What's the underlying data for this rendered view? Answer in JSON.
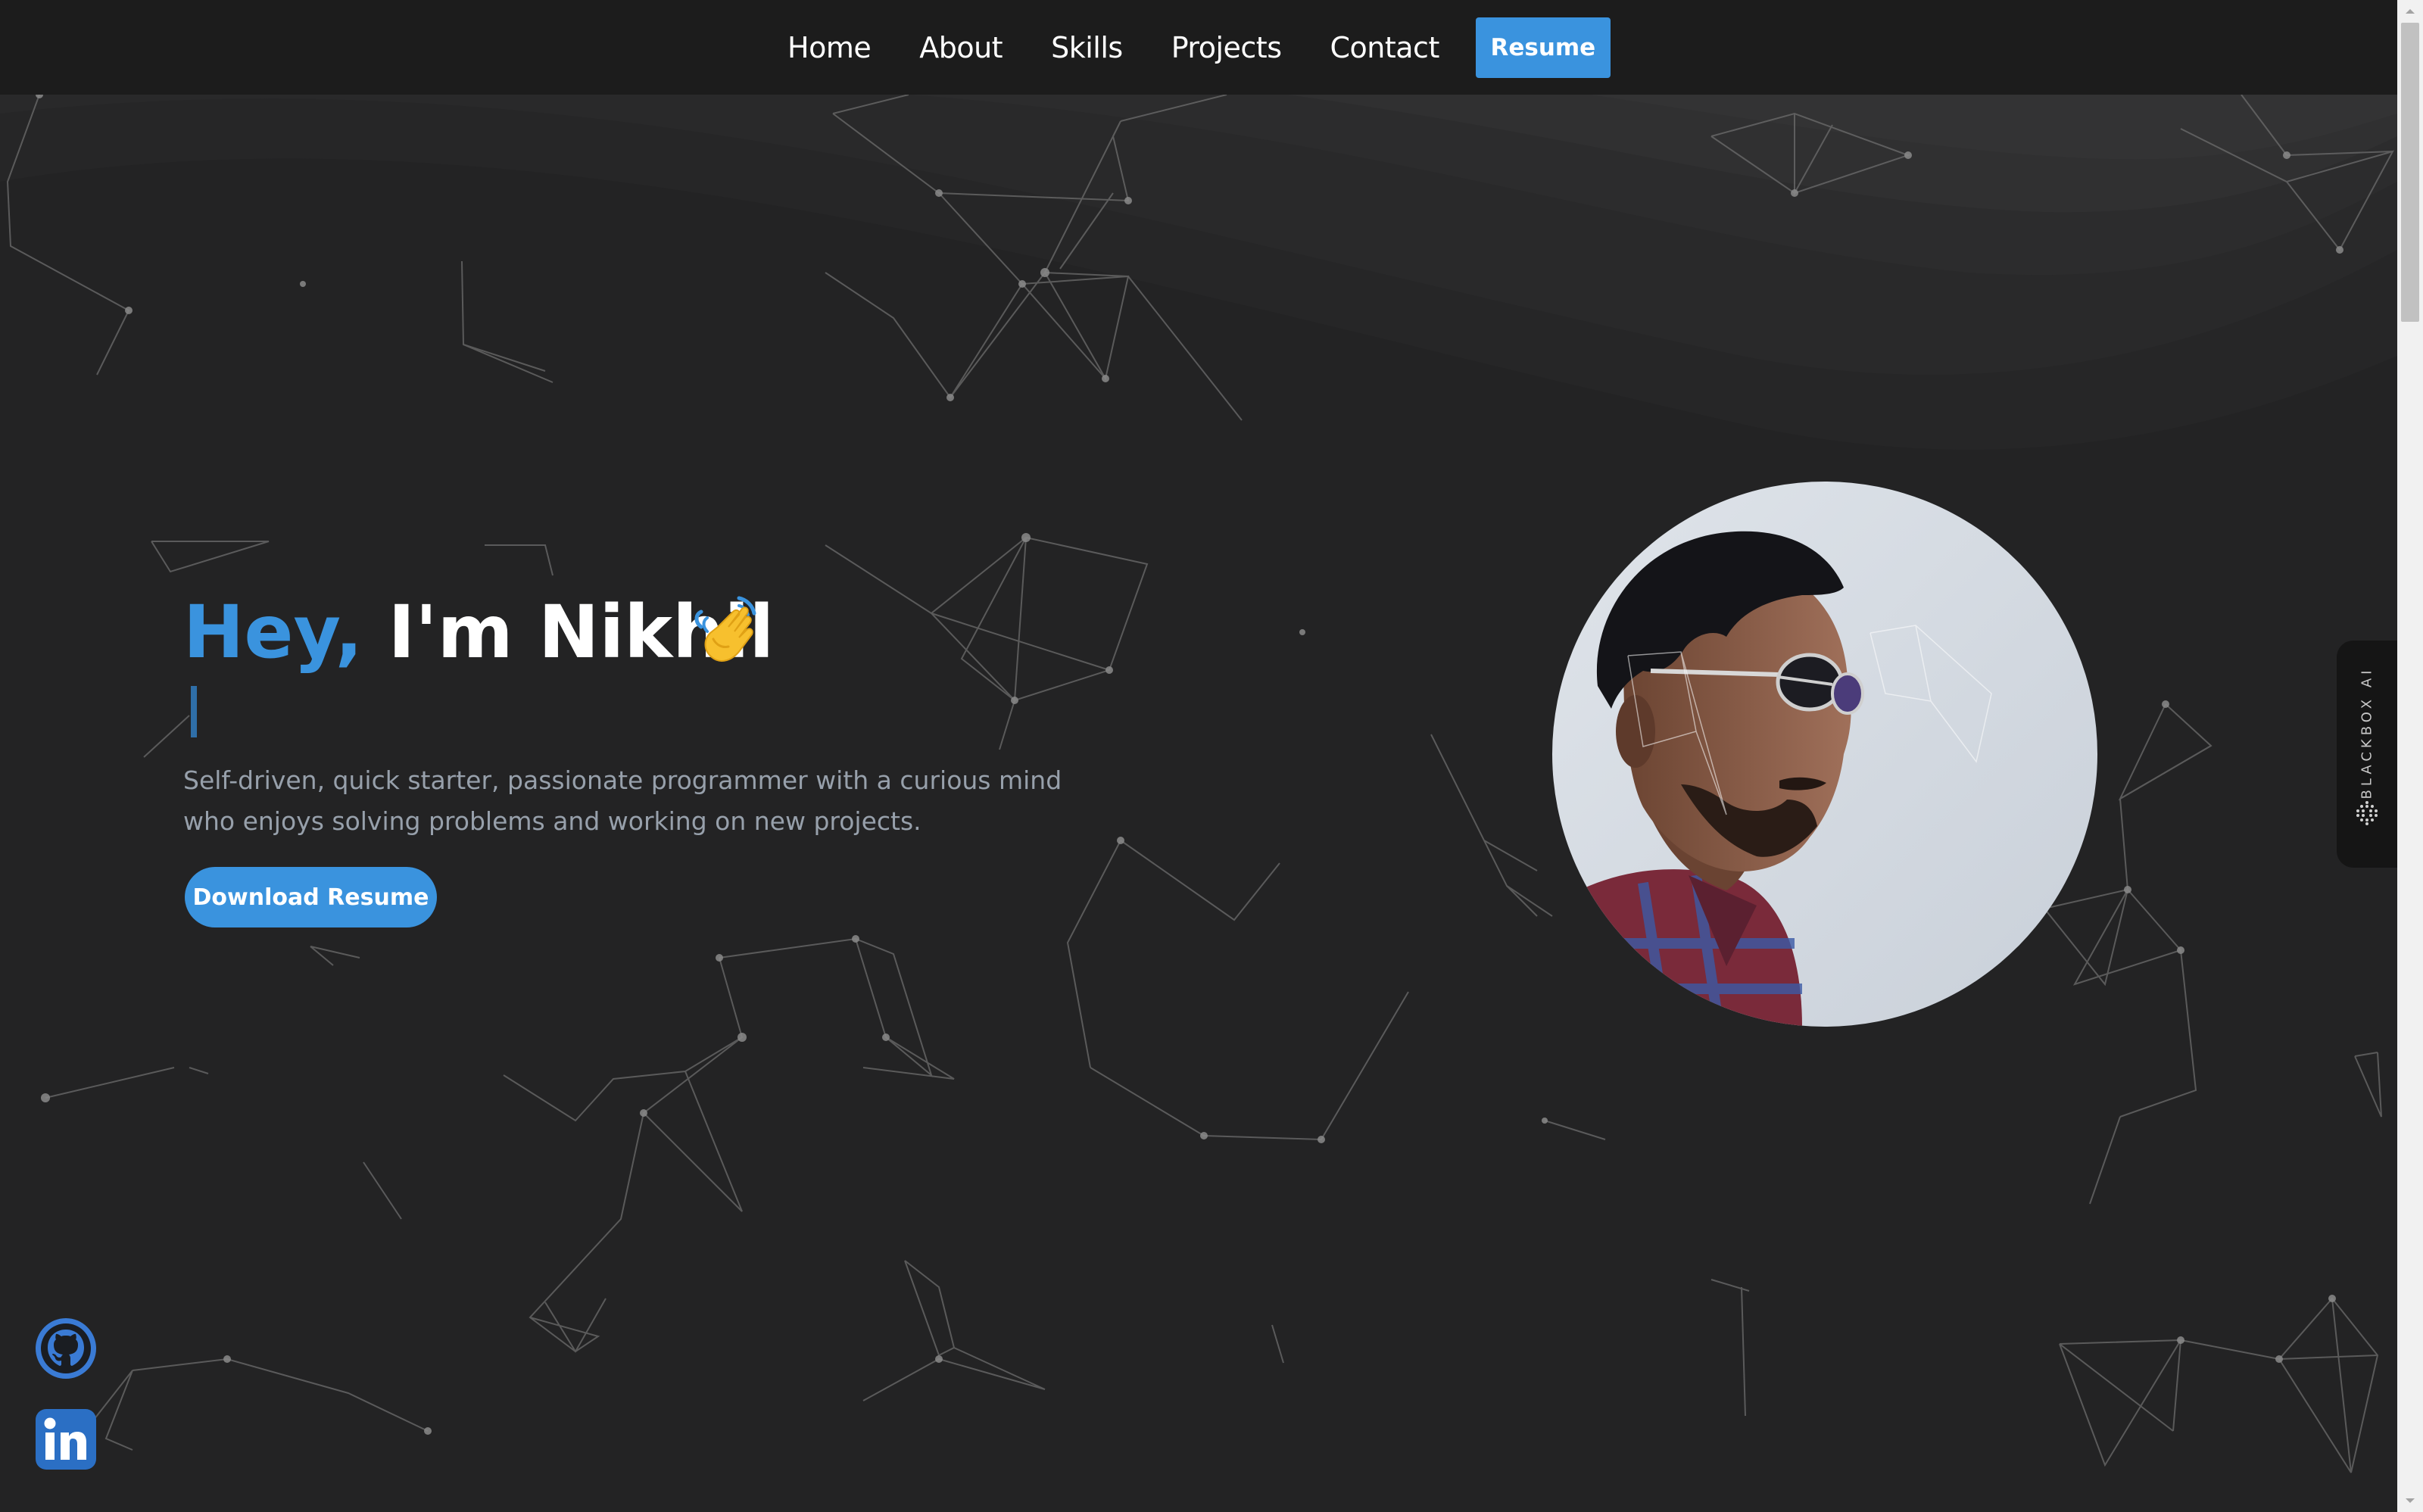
{
  "nav": {
    "items": [
      {
        "label": "Home"
      },
      {
        "label": "About"
      },
      {
        "label": "Skills"
      },
      {
        "label": "Projects"
      },
      {
        "label": "Contact"
      }
    ],
    "resume_label": "Resume"
  },
  "hero": {
    "greeting": "Hey,",
    "name": "I'm Nikhil",
    "wave_icon": "waving-hand-icon",
    "description": "Self-driven, quick starter, passionate programmer with a curious mind who enjoys solving problems and working on new projects.",
    "download_label": "Download Resume"
  },
  "social": {
    "github_icon": "github-icon",
    "linkedin_icon": "linkedin-icon"
  },
  "sidebar_widget": {
    "label": "BLACKBOX AI"
  },
  "colors": {
    "accent": "#3a93de",
    "background": "#232324",
    "navbar": "#1c1c1c",
    "description": "#97a0ab"
  }
}
